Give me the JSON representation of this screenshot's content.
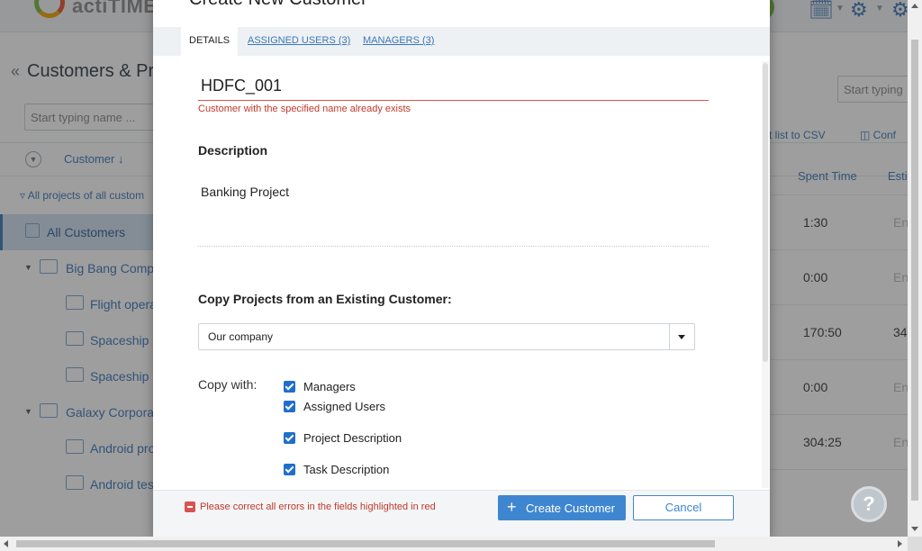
{
  "app": {
    "logo_text": "actiTIME",
    "page_title": "Customers & Pr",
    "search_placeholder": "Start typing name ...",
    "right_search_placeholder": "Start typing",
    "customer_column": "Customer",
    "filter_text": "All projects of all custom",
    "export_link": "rt list to CSV",
    "configure_link": "Conf",
    "tree": [
      {
        "label": "All Customers"
      },
      {
        "label": "Big Bang Comp"
      },
      {
        "label": "Flight opera"
      },
      {
        "label": "Spaceship"
      },
      {
        "label": "Spaceship"
      },
      {
        "label": "Galaxy Corpora"
      },
      {
        "label": "Android pro"
      },
      {
        "label": "Android tes"
      }
    ],
    "table": {
      "headers": [
        "Spent Time",
        "Esti"
      ],
      "spent": [
        "1:30",
        "0:00",
        "170:50",
        "0:00",
        "304:25"
      ],
      "est": [
        "En",
        "En",
        "34",
        "En",
        "En"
      ]
    },
    "help_symbol": "?"
  },
  "modal": {
    "title": "Create New Customer",
    "tabs": [
      "DETAILS",
      "ASSIGNED USERS (3)",
      "MANAGERS (3)"
    ],
    "name_value": "HDFC_001",
    "name_error": "Customer with the specified name already exists",
    "description_label": "Description",
    "description_value": "Banking Project",
    "copy_projects_label": "Copy Projects from an Existing Customer:",
    "copy_from_value": "Our company",
    "copy_with_label": "Copy with:",
    "copy_options": [
      "Managers",
      "Assigned Users",
      "Project Description",
      "Task Description"
    ],
    "footer_error": "Please correct all errors in the fields highlighted in red",
    "create_button": "Create Customer",
    "cancel_button": "Cancel"
  },
  "colors": {
    "accent": "#3f86d0",
    "error": "#c0392b",
    "overlay": "#282828"
  }
}
